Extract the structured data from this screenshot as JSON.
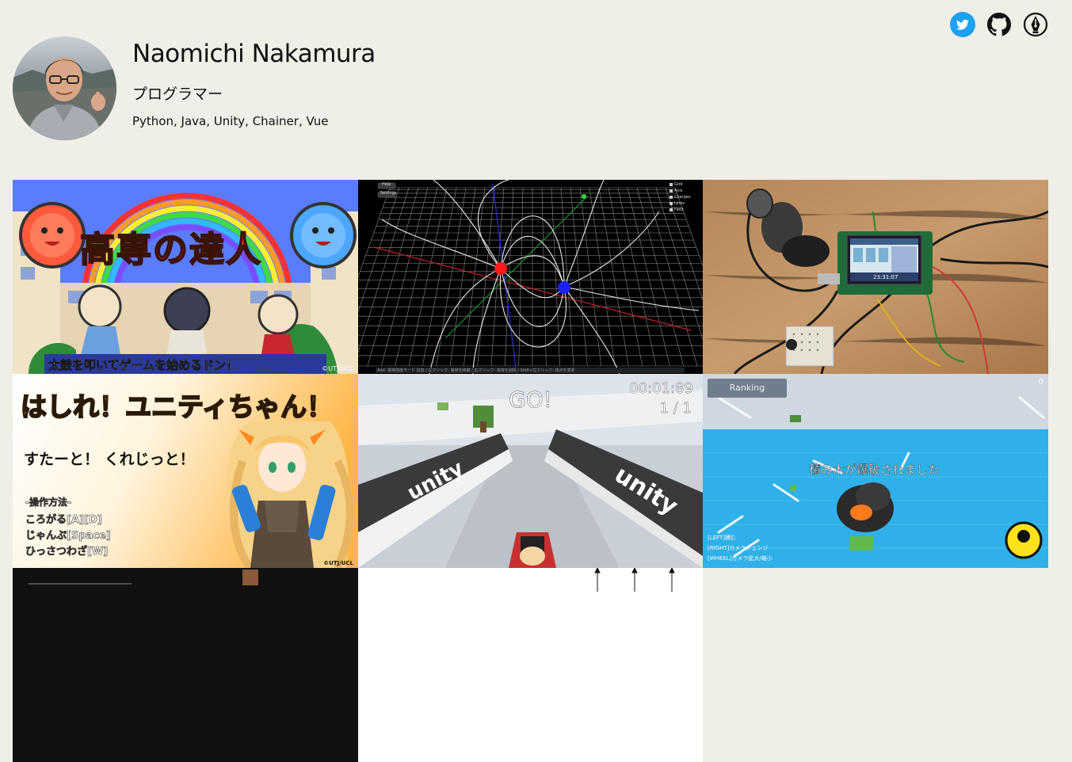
{
  "profile": {
    "name": "Naomichi Nakamura",
    "role": "プログラマー",
    "skills": "Python, Java, Unity, Chainer, Vue"
  },
  "social": [
    {
      "name": "twitter",
      "icon": "twitter-icon",
      "color": "#1da1f2"
    },
    {
      "name": "github",
      "icon": "github-icon",
      "color": "#111111"
    },
    {
      "name": "blog",
      "icon": "pen-nib-icon",
      "color": "#111111"
    }
  ],
  "works": {
    "taiko": {
      "title": "高専の達人",
      "caption": "太鼓を叩いてゲームを始めるドン！",
      "credit": "©UTJ/UCL"
    },
    "field": {
      "button1": "Help",
      "button2": "Settings",
      "checks": [
        "Grid",
        "Axis",
        "Charges",
        "Lines",
        "Field"
      ],
      "status": "Add: 電場強度モード 追加 / 左クリック: 電荷を移動 / 右クリック: 電荷を削除 / Shift+左クリック: 視点を変更"
    },
    "raspi": {
      "time": "23:31:07"
    },
    "runner": {
      "title": "はしれ！ユニティちゃん！",
      "subtitle": "すたーと！ くれじっと！",
      "controls_heading": "-操作方法-",
      "controls": [
        "ころがる[A][D]",
        "じゃんぷ[Space]",
        "ひっさつわざ[W]"
      ],
      "credit": "©UTJ/UCL"
    },
    "racing": {
      "go": "GO!",
      "timer": "00:01:89",
      "lap": "1 / 1",
      "banner": "unity"
    },
    "blocks": {
      "ranking": "Ranking",
      "score": "0",
      "message": "積み木が爆破されました",
      "hints": [
        "[LEFT]積む",
        "[RIGHT]カメラチェンジ",
        "[WHEEL]カメラ拡大/縮小"
      ]
    }
  }
}
